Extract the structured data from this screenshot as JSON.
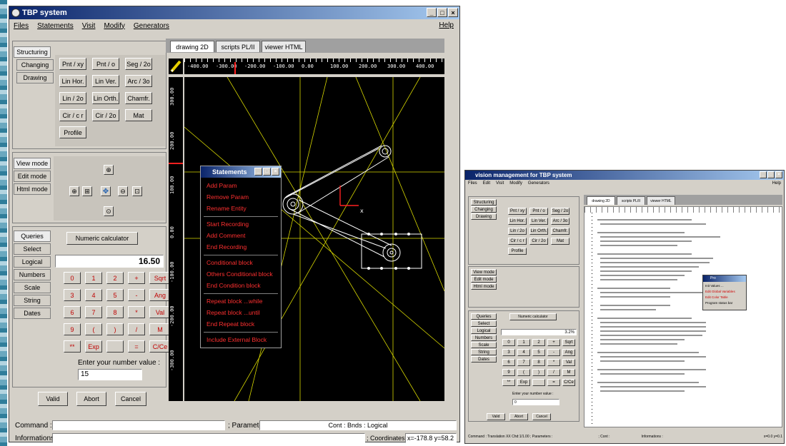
{
  "main_window": {
    "title": "TBP system",
    "menu": [
      "Files",
      "Statements",
      "Visit",
      "Modify",
      "Generators"
    ],
    "help": "Help",
    "win_buttons": [
      "_",
      "□",
      "×"
    ]
  },
  "left_panel": {
    "mode_tabs": [
      "Structuring",
      "Changing",
      "Drawing"
    ],
    "draw_buttons": [
      "Pnt / xy",
      "Pnt / o",
      "Seg / 2o",
      "Lin Hor.",
      "Lin Ver.",
      "Arc / 3o",
      "Lin / 2o",
      "Lin Orth.",
      "Chamfr.",
      "Cir / c r",
      "Cir / 2o",
      "Mat",
      "Profile"
    ],
    "view_tabs": [
      "View mode",
      "Edit mode",
      "Html mode"
    ],
    "query_tabs": [
      "Queries",
      "Select",
      "Logical",
      "Numbers",
      "Scale",
      "String",
      "Dates"
    ],
    "calculator_button": "Numeric calculator",
    "calc_display": "16.50",
    "keypad": [
      "0",
      "1",
      "2",
      "+",
      "Sqrt",
      "3",
      "4",
      "5",
      "-",
      "Ang",
      "6",
      "7",
      "8",
      "*",
      "Val",
      "9",
      "(",
      ")",
      "/",
      "M",
      "**",
      "Exp",
      "",
      "=",
      "C/Ce"
    ],
    "prompt_label": "Enter your number value :",
    "prompt_value": "15",
    "action_buttons": [
      "Valid",
      "Abort",
      "Cancel"
    ]
  },
  "drawing": {
    "tabs": [
      "drawing 2D",
      "scripts PL/II",
      "viewer HTML"
    ],
    "ruler_top": [
      "-400.00",
      "-300.00",
      "-200.00",
      "-100.00",
      "0.00",
      "100.00",
      "200.00",
      "300.00",
      "400.00"
    ],
    "ruler_left": [
      "300.00",
      "200.00",
      "100.00",
      "0.00",
      "-100.00",
      "-200.00",
      "-300.00"
    ],
    "axis_label": "x"
  },
  "statements_popup": {
    "title": "Statements",
    "items": [
      "Add Param",
      "Remove Param",
      "Rename Entity",
      "Start Recording",
      "Add Comment",
      "End Recording",
      "Conditional block",
      "Others Conditional block",
      "End Condition block",
      "Repeat block ...while",
      "Repeat block ...until",
      "End Repeat block",
      "Include External Block"
    ]
  },
  "status": {
    "command_label": "Command :",
    "parameters_label": "; Parameters :",
    "parameters_value": "Cont : Bnds : Logical",
    "informations_label": "Informations :",
    "coordinates_label": "; Coordinates :",
    "coordinates_value": "x=-178.8 y=58.2"
  },
  "right_window": {
    "title": "vision management for TBP system",
    "menu": [
      "Files",
      "Edit",
      "Visit",
      "Modify",
      "Generators"
    ],
    "help": "Help",
    "tabs": [
      "drawing 2D",
      "scripts PL/II",
      "viewer HTML"
    ],
    "calc_display": "3.2%",
    "calculator_button": "Numeric calculator",
    "prompt_label": "Enter your number value :",
    "prompt_value": "0",
    "action_buttons": [
      "Valid",
      "Abort",
      "Cancel"
    ],
    "status_left": "Command : Translation XX  Chd:1/1.00 ; Parameters :",
    "status_cont": "; Cont :",
    "status_info": "Informations :",
    "status_coords": "x=0.0 y=0.1",
    "popup_title": "Pro",
    "popup_items": [
      "Init Values ...",
      "Edit Global Variables",
      "Edit Color Table",
      "Program status bar"
    ]
  }
}
